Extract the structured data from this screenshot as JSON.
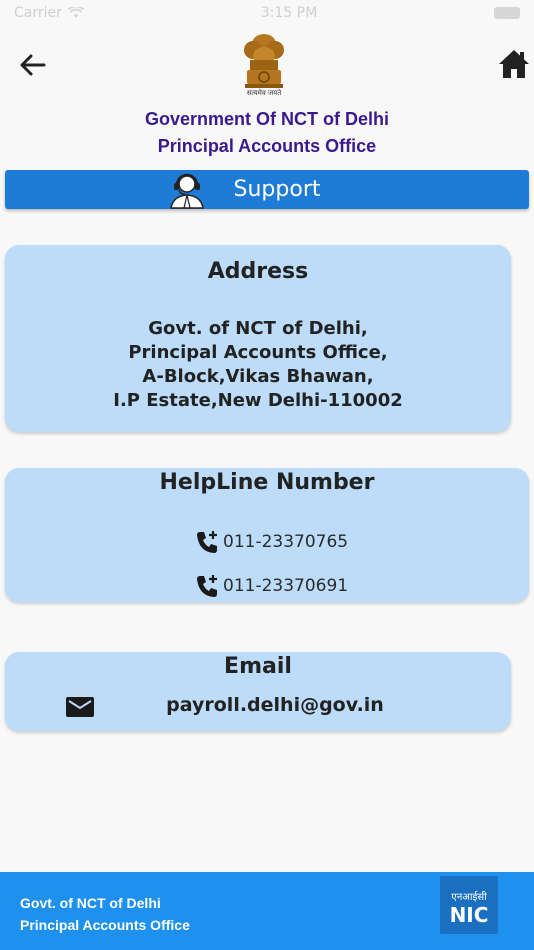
{
  "status_bar": {
    "carrier": "Carrier",
    "time": "3:15 PM"
  },
  "header": {
    "motto": "सत्यमेव जयते",
    "title_line1": "Government Of NCT of Delhi",
    "title_line2": "Principal Accounts Office"
  },
  "support": {
    "title": "Support"
  },
  "address": {
    "title": "Address",
    "lines": [
      "Govt. of NCT of Delhi,",
      "Principal Accounts Office,",
      "A-Block,Vikas Bhawan,",
      "I.P Estate,New Delhi-110002"
    ]
  },
  "helpline": {
    "title": "HelpLine Number",
    "numbers": [
      "011-23370765",
      "011-23370691"
    ]
  },
  "email": {
    "title": "Email",
    "address": "payroll.delhi@gov.in"
  },
  "footer": {
    "line1": "Govt. of  NCT of Delhi",
    "line2": "Principal Accounts Office",
    "logo_text_hindi": "एनआईसी",
    "logo_text": "NIC"
  },
  "icons": {
    "back": "arrow-left-icon",
    "home": "home-icon",
    "support": "customer-support-icon",
    "phone": "phone-add-icon",
    "mail": "mail-icon"
  },
  "colors": {
    "title": "#3a1a8c",
    "support_bar": "#1e7bd6",
    "card": "#bcdcf9",
    "footer": "#1e90ee"
  }
}
